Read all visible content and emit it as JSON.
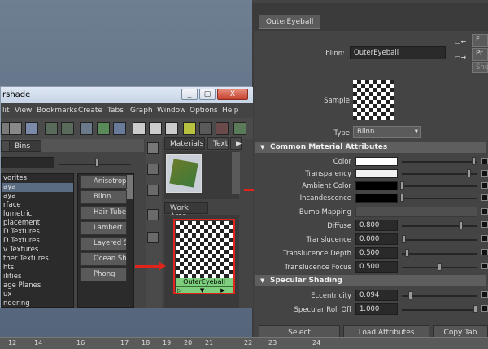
{
  "viewport": {
    "timeline_ticks": [
      "12",
      "14",
      "16",
      "17",
      "18",
      "19",
      "20",
      "21",
      "22",
      "23",
      "24"
    ]
  },
  "hypershade": {
    "title": "rshade",
    "win_buttons": [
      "_",
      "▢",
      "X"
    ],
    "menus": [
      "lit",
      "View",
      "Bookmarks",
      "Create",
      "Tabs",
      "Graph",
      "Window",
      "Options",
      "Help"
    ],
    "bins_tab": "Bins",
    "left_list": [
      "vorites",
      "aya",
      "aya",
      "rface",
      "lumetric",
      "placement",
      "D Textures",
      "D Textures",
      "v Textures",
      "ther Textures",
      "hts",
      "ilities",
      "age Planes",
      "ux",
      "ndering"
    ],
    "materials": [
      {
        "label": "Anisotropic",
        "color": "#9aa2ad"
      },
      {
        "label": "Blinn",
        "color": "#8a93a0"
      },
      {
        "label": "Hair Tube S",
        "color": "#b08060"
      },
      {
        "label": "Lambert",
        "color": "#9a9a9a"
      },
      {
        "label": "Layered Sh",
        "color": "#5a7ab8"
      },
      {
        "label": "Ocean Sha",
        "color": "#4a8ad0"
      },
      {
        "label": "Phong",
        "color": "#b0b0b8"
      }
    ],
    "tabs_top": [
      "Materials",
      "Text"
    ],
    "work_area_tab": "Work Area",
    "node_label": "OuterEyeball"
  },
  "attr_editor": {
    "top_menu": "",
    "tab": "OuterEyeball",
    "shader_label": "blinn:",
    "shader_name": "OuterEyeball",
    "side_buttons": [
      "F",
      "Pr",
      "Show"
    ],
    "sample_label": "Sample",
    "type_label": "Type",
    "type_value": "Blinn",
    "section1": "Common Material Attributes",
    "attributes": [
      {
        "label": "Color",
        "kind": "swatch",
        "color": "#ffffff"
      },
      {
        "label": "Transparency",
        "kind": "swatch",
        "color": "#f2f2f2"
      },
      {
        "label": "Ambient Color",
        "kind": "swatch",
        "color": "#000000"
      },
      {
        "label": "Incandescence",
        "kind": "swatch",
        "color": "#000000"
      },
      {
        "label": "Bump Mapping",
        "kind": "bump",
        "value": ""
      },
      {
        "label": "Diffuse",
        "kind": "num",
        "value": "0.800",
        "level": 0.8
      },
      {
        "label": "Translucence",
        "kind": "num",
        "value": "0.000",
        "level": 0.0
      },
      {
        "label": "Translucence Depth",
        "kind": "num",
        "value": "0.500",
        "level": 0.05
      },
      {
        "label": "Translucence Focus",
        "kind": "num",
        "value": "0.500",
        "level": 0.5
      }
    ],
    "section2": "Specular Shading",
    "specular": [
      {
        "label": "Eccentricity",
        "value": "0.094",
        "level": 0.094
      },
      {
        "label": "Specular Roll Off",
        "value": "1.000",
        "level": 1.0
      }
    ],
    "bottom_buttons": [
      "Select",
      "Load Attributes",
      "Copy Tab"
    ]
  }
}
